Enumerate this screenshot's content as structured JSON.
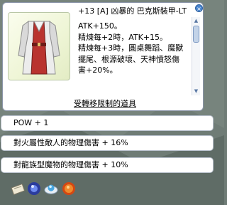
{
  "item": {
    "title": "+13 [A] 凶暴的 巴克斯裝甲-LT",
    "description": [
      "ATK+150。",
      "精煉每+2時，ATK+15。",
      "精煉每+3時，圓桌舞蹈、魔獸",
      "擺尾、根源破壞、天神憤怒傷",
      "害+20%。"
    ],
    "restriction": "受轉移限制的道具"
  },
  "close_glyph": "×",
  "scroll": {
    "up_glyph": "▲",
    "down_glyph": "▼"
  },
  "options": [
    "POW + 1",
    "對火屬性敵人的物理傷害 + 16%",
    "對龍族型魔物的物理傷害 + 10%"
  ],
  "icons": [
    "scroll-icon",
    "blue-orb-icon",
    "crystal-disc-icon",
    "fire-gem-icon"
  ],
  "colors": {
    "panel_border": "#8a94a8",
    "image_bg": "#eef5d5",
    "accent": "#4a86d0"
  }
}
